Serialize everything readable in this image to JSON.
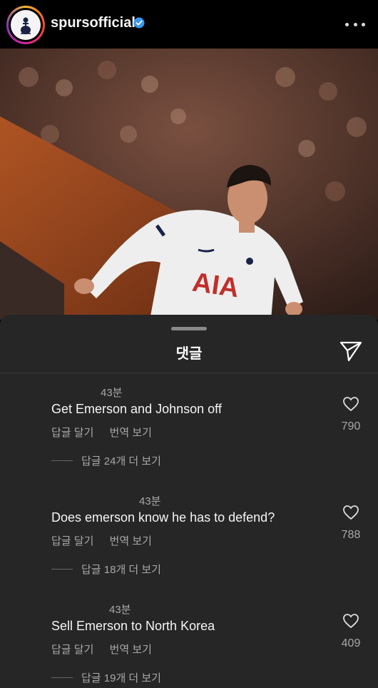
{
  "header": {
    "username": "spursofficial",
    "verified_icon": "verified-badge-icon",
    "more_icon": "more-options-icon"
  },
  "photo": {
    "shirt_text": "AIA"
  },
  "sheet": {
    "title": "댓글",
    "send_icon": "send-icon"
  },
  "comments": [
    {
      "time": "43분",
      "text": "Get Emerson and Johnson off",
      "reply": "답글 달기",
      "translate": "번역 보기",
      "more_replies": "답글 24개 더 보기",
      "likes": "790"
    },
    {
      "time": "43분",
      "text": "Does emerson know he has to defend?",
      "reply": "답글 달기",
      "translate": "번역 보기",
      "more_replies": "답글 18개 더 보기",
      "likes": "788"
    },
    {
      "time": "43분",
      "text": "Sell Emerson to North Korea",
      "reply": "답글 달기",
      "translate": "번역 보기",
      "more_replies": "답글 19개 더 보기",
      "likes": "409"
    }
  ],
  "colors": {
    "background": "#000000",
    "sheet": "#262626",
    "secondary_text": "#a8a8a8",
    "verified": "#3897f0"
  }
}
